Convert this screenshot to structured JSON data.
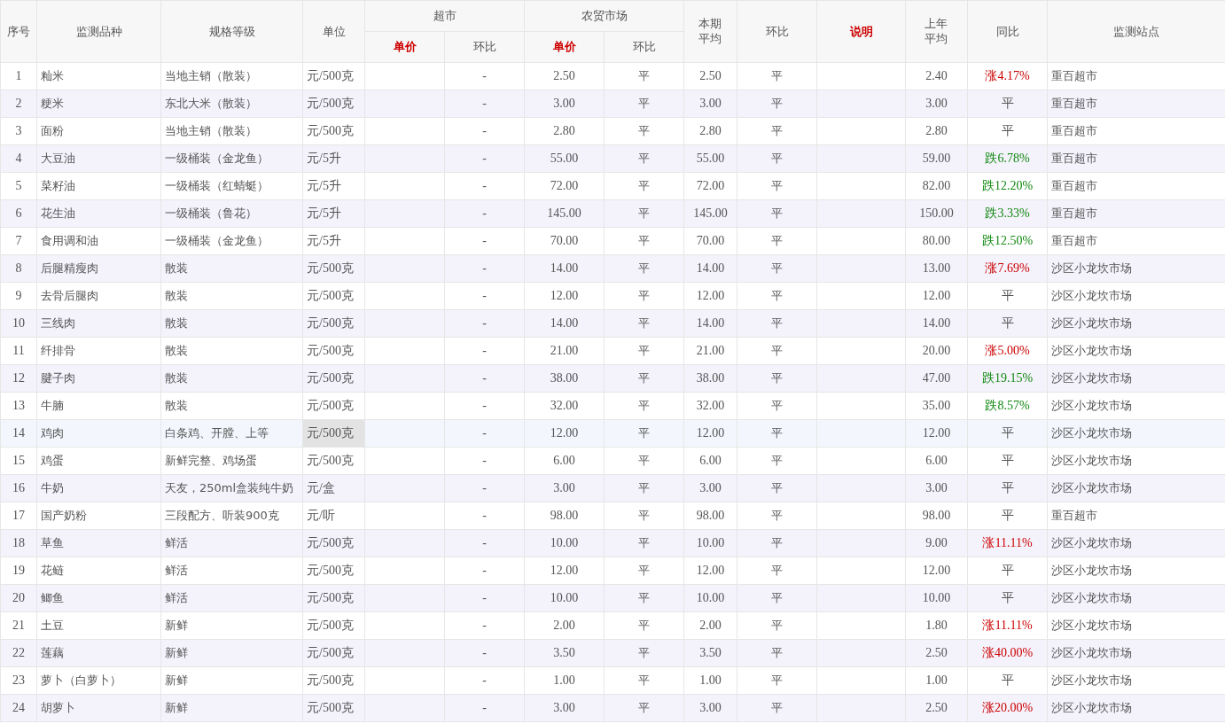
{
  "table": {
    "columns": [
      {
        "label": "序号"
      },
      {
        "label": "监测品种"
      },
      {
        "label": "规格等级"
      },
      {
        "label": "单位"
      },
      {
        "label": "超市",
        "children": [
          {
            "label": "单价",
            "highlighted": true
          },
          {
            "label": "环比",
            "highlighted": false
          }
        ]
      },
      {
        "label": "农贸市场",
        "children": [
          {
            "label": "单价",
            "highlighted": true
          },
          {
            "label": "环比",
            "highlighted": false
          }
        ]
      },
      {
        "label": "本期平均",
        "highlighted": false
      },
      {
        "label": "环比",
        "highlighted": false
      },
      {
        "label": "说明",
        "highlighted": true
      },
      {
        "label": "上年平均",
        "highlighted": false
      },
      {
        "label": "同比",
        "highlighted": false
      },
      {
        "label": "监测站点",
        "highlighted": false
      }
    ],
    "rows": [
      {
        "no": "1",
        "name": "籼米",
        "spec": "当地主销（散装）",
        "unit": "元/500克",
        "super_ratio": "-",
        "farm_price": "2.50",
        "farm_ratio": "平",
        "avg": "2.50",
        "ratio": "平",
        "last_year": "2.40",
        "yoy": "涨4.17%",
        "kind": "up",
        "station": "重百超市",
        "hovered": false
      },
      {
        "no": "2",
        "name": "粳米",
        "spec": "东北大米（散装）",
        "unit": "元/500克",
        "super_ratio": "-",
        "farm_price": "3.00",
        "farm_ratio": "平",
        "avg": "3.00",
        "ratio": "平",
        "last_year": "3.00",
        "yoy": "平",
        "kind": "flat",
        "station": "重百超市",
        "hovered": false
      },
      {
        "no": "3",
        "name": "面粉",
        "spec": "当地主销（散装）",
        "unit": "元/500克",
        "super_ratio": "-",
        "farm_price": "2.80",
        "farm_ratio": "平",
        "avg": "2.80",
        "ratio": "平",
        "last_year": "2.80",
        "yoy": "平",
        "kind": "flat",
        "station": "重百超市",
        "hovered": false
      },
      {
        "no": "4",
        "name": "大豆油",
        "spec": "一级桶装（金龙鱼）",
        "unit": "元/5升",
        "super_ratio": "-",
        "farm_price": "55.00",
        "farm_ratio": "平",
        "avg": "55.00",
        "ratio": "平",
        "last_year": "59.00",
        "yoy": "跌6.78%",
        "kind": "down",
        "station": "重百超市",
        "hovered": false
      },
      {
        "no": "5",
        "name": "菜籽油",
        "spec": "一级桶装（红蜻蜓）",
        "unit": "元/5升",
        "super_ratio": "-",
        "farm_price": "72.00",
        "farm_ratio": "平",
        "avg": "72.00",
        "ratio": "平",
        "last_year": "82.00",
        "yoy": "跌12.20%",
        "kind": "down",
        "station": "重百超市",
        "hovered": false
      },
      {
        "no": "6",
        "name": "花生油",
        "spec": "一级桶装（鲁花）",
        "unit": "元/5升",
        "super_ratio": "-",
        "farm_price": "145.00",
        "farm_ratio": "平",
        "avg": "145.00",
        "ratio": "平",
        "last_year": "150.00",
        "yoy": "跌3.33%",
        "kind": "down",
        "station": "重百超市",
        "hovered": false
      },
      {
        "no": "7",
        "name": "食用调和油",
        "spec": "一级桶装（金龙鱼）",
        "unit": "元/5升",
        "super_ratio": "-",
        "farm_price": "70.00",
        "farm_ratio": "平",
        "avg": "70.00",
        "ratio": "平",
        "last_year": "80.00",
        "yoy": "跌12.50%",
        "kind": "down",
        "station": "重百超市",
        "hovered": false
      },
      {
        "no": "8",
        "name": "后腿精瘦肉",
        "spec": "散装",
        "unit": "元/500克",
        "super_ratio": "-",
        "farm_price": "14.00",
        "farm_ratio": "平",
        "avg": "14.00",
        "ratio": "平",
        "last_year": "13.00",
        "yoy": "涨7.69%",
        "kind": "up",
        "station": "沙区小龙坎市场",
        "hovered": false
      },
      {
        "no": "9",
        "name": "去骨后腿肉",
        "spec": "散装",
        "unit": "元/500克",
        "super_ratio": "-",
        "farm_price": "12.00",
        "farm_ratio": "平",
        "avg": "12.00",
        "ratio": "平",
        "last_year": "12.00",
        "yoy": "平",
        "kind": "flat",
        "station": "沙区小龙坎市场",
        "hovered": false
      },
      {
        "no": "10",
        "name": "三线肉",
        "spec": "散装",
        "unit": "元/500克",
        "super_ratio": "-",
        "farm_price": "14.00",
        "farm_ratio": "平",
        "avg": "14.00",
        "ratio": "平",
        "last_year": "14.00",
        "yoy": "平",
        "kind": "flat",
        "station": "沙区小龙坎市场",
        "hovered": false
      },
      {
        "no": "11",
        "name": "纤排骨",
        "spec": "散装",
        "unit": "元/500克",
        "super_ratio": "-",
        "farm_price": "21.00",
        "farm_ratio": "平",
        "avg": "21.00",
        "ratio": "平",
        "last_year": "20.00",
        "yoy": "涨5.00%",
        "kind": "up",
        "station": "沙区小龙坎市场",
        "hovered": false
      },
      {
        "no": "12",
        "name": "腱子肉",
        "spec": "散装",
        "unit": "元/500克",
        "super_ratio": "-",
        "farm_price": "38.00",
        "farm_ratio": "平",
        "avg": "38.00",
        "ratio": "平",
        "last_year": "47.00",
        "yoy": "跌19.15%",
        "kind": "down",
        "station": "沙区小龙坎市场",
        "hovered": false
      },
      {
        "no": "13",
        "name": "牛腩",
        "spec": "散装",
        "unit": "元/500克",
        "super_ratio": "-",
        "farm_price": "32.00",
        "farm_ratio": "平",
        "avg": "32.00",
        "ratio": "平",
        "last_year": "35.00",
        "yoy": "跌8.57%",
        "kind": "down",
        "station": "沙区小龙坎市场",
        "hovered": false
      },
      {
        "no": "14",
        "name": "鸡肉",
        "spec": "白条鸡、开膛、上等",
        "unit": "元/500克",
        "super_ratio": "-",
        "farm_price": "12.00",
        "farm_ratio": "平",
        "avg": "12.00",
        "ratio": "平",
        "last_year": "12.00",
        "yoy": "平",
        "kind": "flat",
        "station": "沙区小龙坎市场",
        "hovered": true
      },
      {
        "no": "15",
        "name": "鸡蛋",
        "spec": "新鲜完整、鸡场蛋",
        "unit": "元/500克",
        "super_ratio": "-",
        "farm_price": "6.00",
        "farm_ratio": "平",
        "avg": "6.00",
        "ratio": "平",
        "last_year": "6.00",
        "yoy": "平",
        "kind": "flat",
        "station": "沙区小龙坎市场",
        "hovered": false
      },
      {
        "no": "16",
        "name": "牛奶",
        "spec": "天友，250ml盒装纯牛奶",
        "unit": "元/盒",
        "super_ratio": "-",
        "farm_price": "3.00",
        "farm_ratio": "平",
        "avg": "3.00",
        "ratio": "平",
        "last_year": "3.00",
        "yoy": "平",
        "kind": "flat",
        "station": "沙区小龙坎市场",
        "hovered": false
      },
      {
        "no": "17",
        "name": "国产奶粉",
        "spec": "三段配方、听装900克",
        "unit": "元/听",
        "super_ratio": "-",
        "farm_price": "98.00",
        "farm_ratio": "平",
        "avg": "98.00",
        "ratio": "平",
        "last_year": "98.00",
        "yoy": "平",
        "kind": "flat",
        "station": "重百超市",
        "hovered": false
      },
      {
        "no": "18",
        "name": "草鱼",
        "spec": "鲜活",
        "unit": "元/500克",
        "super_ratio": "-",
        "farm_price": "10.00",
        "farm_ratio": "平",
        "avg": "10.00",
        "ratio": "平",
        "last_year": "9.00",
        "yoy": "涨11.11%",
        "kind": "up",
        "station": "沙区小龙坎市场",
        "hovered": false
      },
      {
        "no": "19",
        "name": "花鲢",
        "spec": "鲜活",
        "unit": "元/500克",
        "super_ratio": "-",
        "farm_price": "12.00",
        "farm_ratio": "平",
        "avg": "12.00",
        "ratio": "平",
        "last_year": "12.00",
        "yoy": "平",
        "kind": "flat",
        "station": "沙区小龙坎市场",
        "hovered": false
      },
      {
        "no": "20",
        "name": "鲫鱼",
        "spec": "鲜活",
        "unit": "元/500克",
        "super_ratio": "-",
        "farm_price": "10.00",
        "farm_ratio": "平",
        "avg": "10.00",
        "ratio": "平",
        "last_year": "10.00",
        "yoy": "平",
        "kind": "flat",
        "station": "沙区小龙坎市场",
        "hovered": false
      },
      {
        "no": "21",
        "name": "土豆",
        "spec": "新鲜",
        "unit": "元/500克",
        "super_ratio": "-",
        "farm_price": "2.00",
        "farm_ratio": "平",
        "avg": "2.00",
        "ratio": "平",
        "last_year": "1.80",
        "yoy": "涨11.11%",
        "kind": "up",
        "station": "沙区小龙坎市场",
        "hovered": false
      },
      {
        "no": "22",
        "name": "莲藕",
        "spec": "新鲜",
        "unit": "元/500克",
        "super_ratio": "-",
        "farm_price": "3.50",
        "farm_ratio": "平",
        "avg": "3.50",
        "ratio": "平",
        "last_year": "2.50",
        "yoy": "涨40.00%",
        "kind": "up",
        "station": "沙区小龙坎市场",
        "hovered": false
      },
      {
        "no": "23",
        "name": "萝卜（白萝卜）",
        "spec": "新鲜",
        "unit": "元/500克",
        "super_ratio": "-",
        "farm_price": "1.00",
        "farm_ratio": "平",
        "avg": "1.00",
        "ratio": "平",
        "last_year": "1.00",
        "yoy": "平",
        "kind": "flat",
        "station": "沙区小龙坎市场",
        "hovered": false
      },
      {
        "no": "24",
        "name": "胡萝卜",
        "spec": "新鲜",
        "unit": "元/500克",
        "super_ratio": "-",
        "farm_price": "3.00",
        "farm_ratio": "平",
        "avg": "3.00",
        "ratio": "平",
        "last_year": "2.50",
        "yoy": "涨20.00%",
        "kind": "up",
        "station": "沙区小龙坎市场",
        "hovered": false
      }
    ]
  }
}
